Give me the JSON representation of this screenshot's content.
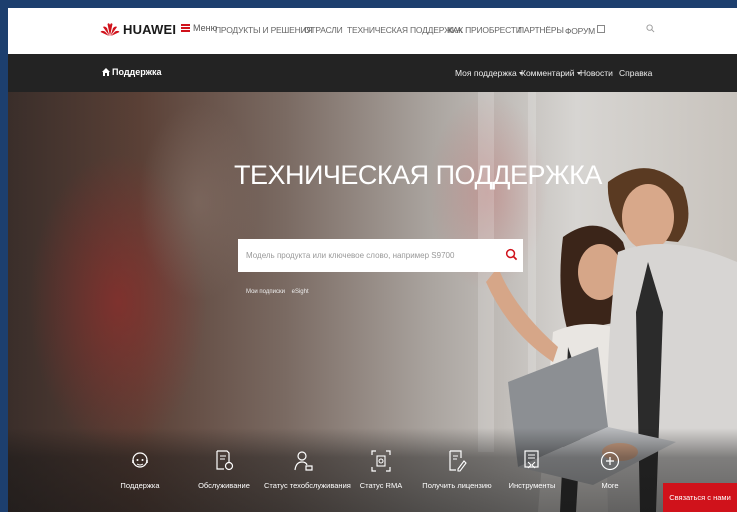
{
  "brand": {
    "name": "HUAWEI",
    "red": "#d0121b"
  },
  "topnav": {
    "menu_label": "Меню",
    "links": [
      "ПРОДУКТЫ И РЕШЕНИЯ",
      "ОТРАСЛИ",
      "ТЕХНИЧЕСКАЯ ПОДДЕРЖКА",
      "КАК ПРИОБРЕСТИ",
      "ПАРТНЁРЫ",
      "ФОРУМ"
    ],
    "search_icon": "search-icon"
  },
  "subnav": {
    "home_label": "Поддержка",
    "links": [
      "Моя поддержка",
      "Комментарий",
      "Новости",
      "Справка"
    ]
  },
  "hero": {
    "title": "ТЕХНИЧЕСКАЯ ПОДДЕРЖКА",
    "search_placeholder": "Модель продукта или ключевое слово, например S9700",
    "quick_links": [
      "Мои подписки",
      "eSight"
    ]
  },
  "services": [
    {
      "label": "Поддержка",
      "icon": "headset-icon"
    },
    {
      "label": "Обслуживание",
      "icon": "document-settings-icon"
    },
    {
      "label": "Статус техобслуживания",
      "icon": "user-wrench-icon"
    },
    {
      "label": "Статус RMA",
      "icon": "scan-box-icon"
    },
    {
      "label": "Получить лицензию",
      "icon": "license-pen-icon"
    },
    {
      "label": "Инструменты",
      "icon": "toolbox-icon"
    },
    {
      "label": "More",
      "icon": "plus-circle-icon"
    }
  ],
  "contact_button": "Связаться с нами"
}
